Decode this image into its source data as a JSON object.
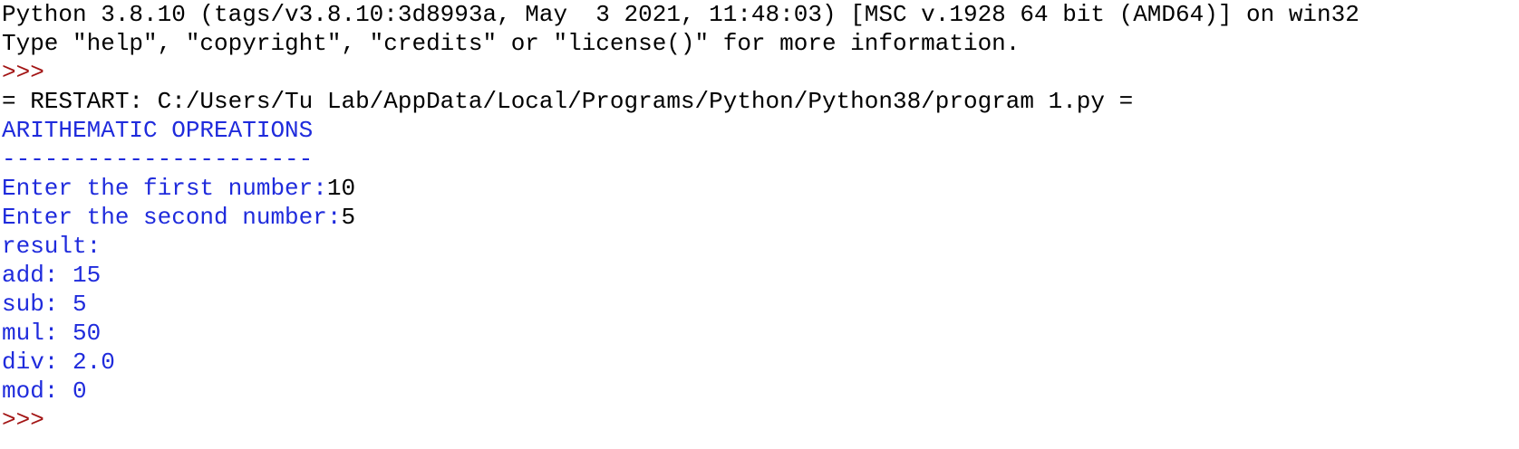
{
  "shell": {
    "banner_line_1": "Python 3.8.10 (tags/v3.8.10:3d8993a, May  3 2021, 11:48:03) [MSC v.1928 64 bit (AMD64)] on win32",
    "banner_line_2": "Type \"help\", \"copyright\", \"credits\" or \"license()\" for more information.",
    "prompt": ">>> ",
    "restart_line": "= RESTART: C:/Users/Tu Lab/AppData/Local/Programs/Python/Python38/program 1.py =",
    "program_output": {
      "heading": "ARITHEMATIC OPREATIONS",
      "underline": "----------------------",
      "first_prompt": "Enter the first number:",
      "first_input": "10",
      "second_prompt": "Enter the second number:",
      "second_input": "5",
      "result_label": "result:",
      "results": [
        "add: 15",
        "sub: 5",
        "mul: 50",
        "div: 2.0",
        "mod: 0"
      ]
    },
    "colors": {
      "stdout": "#1f2bdc",
      "stdin": "#000000",
      "prompt": "#a31515",
      "console_text": "#000000",
      "background": "#ffffff"
    }
  }
}
